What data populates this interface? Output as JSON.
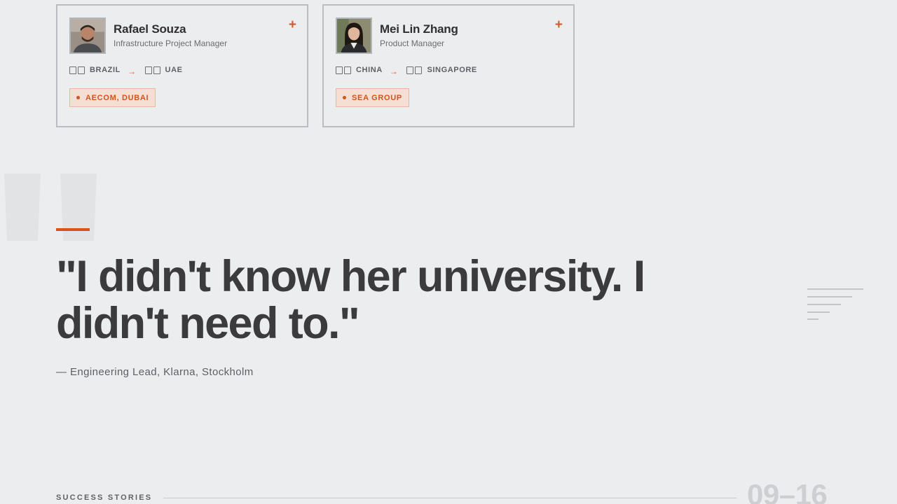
{
  "profiles": [
    {
      "name": "Rafael Souza",
      "role": "Infrastructure Project Manager",
      "from_country": "BRAZIL",
      "to_country": "UAE",
      "arrow": "→",
      "company": "AECOM, DUBAI",
      "action": "+"
    },
    {
      "name": "Mei Lin Zhang",
      "role": "Product Manager",
      "from_country": "CHINA",
      "to_country": "SINGAPORE",
      "arrow": "→",
      "company": "SEA GROUP",
      "action": "+"
    }
  ],
  "testimonial": {
    "quote": "\"I didn't know her university. I didn't need to.\"",
    "attribution": "— Engineering Lead, Klarna, Stockholm"
  },
  "footer": {
    "section_label": "SUCCESS STORIES",
    "counter": "09–16"
  },
  "colors": {
    "accent": "#d6541f",
    "background": "#ecedef",
    "text": "#3b3b3d",
    "tag_background": "#f5ded3"
  },
  "icons": {
    "card_action": "plus-icon",
    "flag": "flag-placeholder-icon",
    "route_arrow": "arrow-right-icon",
    "tag_dot": "dot-icon",
    "quote_decoration": "quote-mark-icon",
    "side_decoration": "text-lines-icon"
  }
}
